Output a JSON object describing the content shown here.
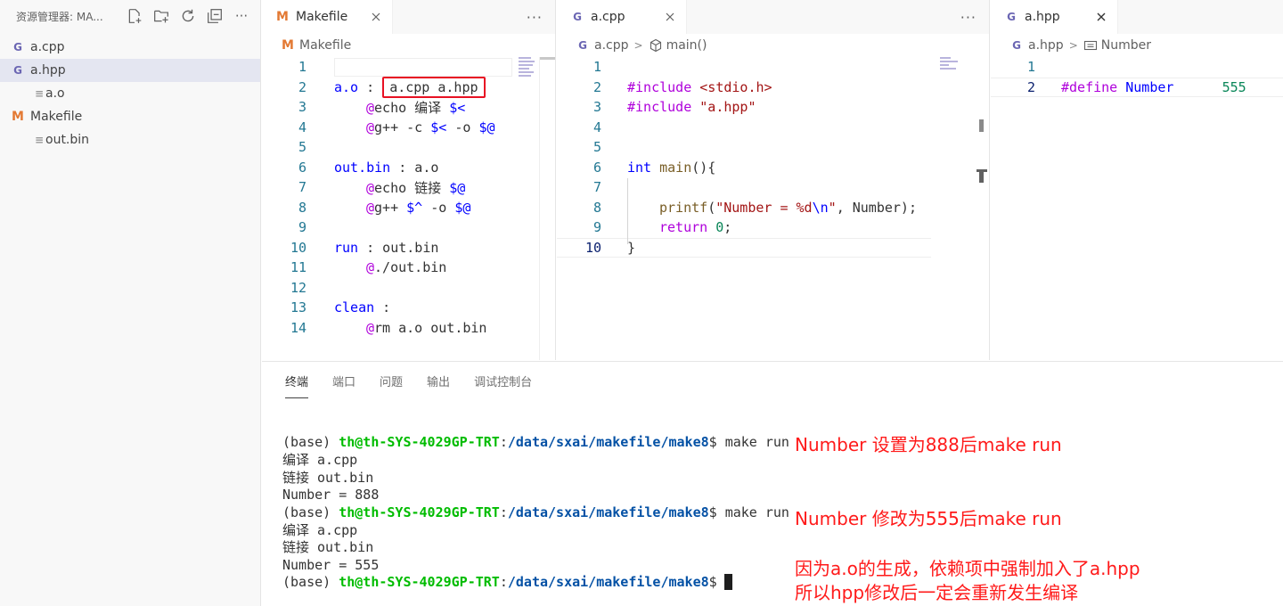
{
  "sidebar": {
    "title": "资源管理器: MA...",
    "files": [
      {
        "name": "a.cpp",
        "icon": "cpp-icon"
      },
      {
        "name": "a.hpp",
        "icon": "cpp-icon"
      },
      {
        "name": "a.o",
        "icon": "text-file-icon"
      },
      {
        "name": "Makefile",
        "icon": "makefile-icon"
      },
      {
        "name": "out.bin",
        "icon": "text-file-icon"
      }
    ],
    "selected": "a.hpp"
  },
  "groups": {
    "makefile": {
      "tab_label": "Makefile",
      "breadcrumb": "Makefile",
      "line_numbers": [
        "1",
        "2",
        "3",
        "4",
        "5",
        "6",
        "7",
        "8",
        "9",
        "10",
        "11",
        "12",
        "13",
        "14"
      ]
    },
    "cpp": {
      "tab_label": "a.cpp",
      "breadcrumb_file": "a.cpp",
      "breadcrumb_symbol": "main()",
      "line_numbers": [
        "1",
        "2",
        "3",
        "4",
        "5",
        "6",
        "7",
        "8",
        "9",
        "10"
      ]
    },
    "hpp": {
      "tab_label": "a.hpp",
      "breadcrumb_file": "a.hpp",
      "breadcrumb_symbol": "Number",
      "line_numbers": [
        "1",
        "2"
      ]
    }
  },
  "code": {
    "mk": {
      "l2a": "a.o",
      "l2b": " : ",
      "l2c": "a.cpp a.hpp",
      "l3a": "@",
      "l3b": "echo 编译 ",
      "l3c": "$<",
      "l4a": "@",
      "l4b": "g++ -c ",
      "l4c": "$<",
      "l4d": " -o ",
      "l4e": "$@",
      "l6a": "out.bin",
      "l6b": " : a.o",
      "l7a": "@",
      "l7b": "echo 链接 ",
      "l7c": "$@",
      "l8a": "@",
      "l8b": "g++ ",
      "l8c": "$^",
      "l8d": " -o ",
      "l8e": "$@",
      "l10a": "run",
      "l10b": " : out.bin",
      "l11a": "@",
      "l11b": "./out.bin",
      "l13a": "clean",
      "l13b": " :",
      "l14a": "@",
      "l14b": "rm a.o out.bin"
    },
    "cpp": {
      "l2a": "#include",
      "l2b": " <stdio.h>",
      "l3a": "#include",
      "l3b": " \"a.hpp\"",
      "l6a": "int",
      "l6b": " main",
      "l6c": "(){",
      "l8a": "printf",
      "l8b": "(",
      "l8c": "\"Number = %d",
      "l8d": "\\n",
      "l8e": "\"",
      "l8f": ", Number);",
      "l9a": "return",
      "l9b": " ",
      "l9c": "0",
      "l9d": ";",
      "l10a": "}"
    },
    "hpp": {
      "l2a": "#define",
      "l2b": " Number",
      "l2c": "      ",
      "l2d": "555"
    }
  },
  "panel": {
    "tabs": [
      "终端",
      "端口",
      "问题",
      "输出",
      "调试控制台"
    ],
    "active_tab": "终端"
  },
  "terminal": {
    "base": "(base) ",
    "userhost": "th@th-SYS-4029GP-TRT",
    "colon": ":",
    "path": "/data/sxai/makefile/make8",
    "cmd": "$ make run",
    "prompt_end": "$",
    "compile": "编译 a.cpp",
    "link": "链接 out.bin",
    "out888": "Number = 888",
    "out555": "Number = 555"
  },
  "annotations": {
    "a1": "Number 设置为888后make run",
    "a2": "Number 修改为555后make run",
    "a3": "因为a.o的生成，依赖项中强制加入了a.hpp",
    "a4": "所以hpp修改后一定会重新发生编译"
  },
  "colors": {
    "annotation_red": "#ff1a1a",
    "highlight_box": "#e81123",
    "terminal_green": "#00bc00",
    "terminal_blue": "#0451a5"
  }
}
